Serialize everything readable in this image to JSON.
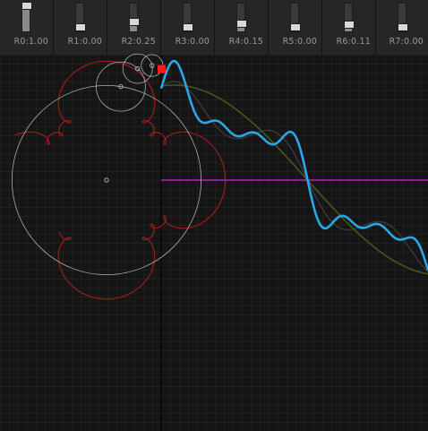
{
  "toolbar": {
    "sliders": [
      {
        "label": "R0:1.00",
        "value": 1.0
      },
      {
        "label": "R1:0.00",
        "value": 0.0
      },
      {
        "label": "R2:0.25",
        "value": 0.25
      },
      {
        "label": "R3:0.00",
        "value": 0.0
      },
      {
        "label": "R4:0.15",
        "value": 0.15
      },
      {
        "label": "R5:0.00",
        "value": 0.0
      },
      {
        "label": "R6:0.11",
        "value": 0.11
      },
      {
        "label": "R7:0.00",
        "value": 0.0
      }
    ]
  },
  "colors": {
    "background": "#151515",
    "grid": "#2a2a2a",
    "epicycle_circles": "#c8c8c8",
    "traced_path": "#a01a1a",
    "pen_point": "#ff1a1a",
    "fourier_wave": "#2aa7e8",
    "fundamental_wave": "#3e5a1c",
    "faint_wave": "#3a3a3a",
    "axis_line": "#b020c0",
    "divider": "#000000"
  },
  "icons": {
    "pen_point": "square-marker-icon",
    "circle_center": "small-circle-icon"
  }
}
